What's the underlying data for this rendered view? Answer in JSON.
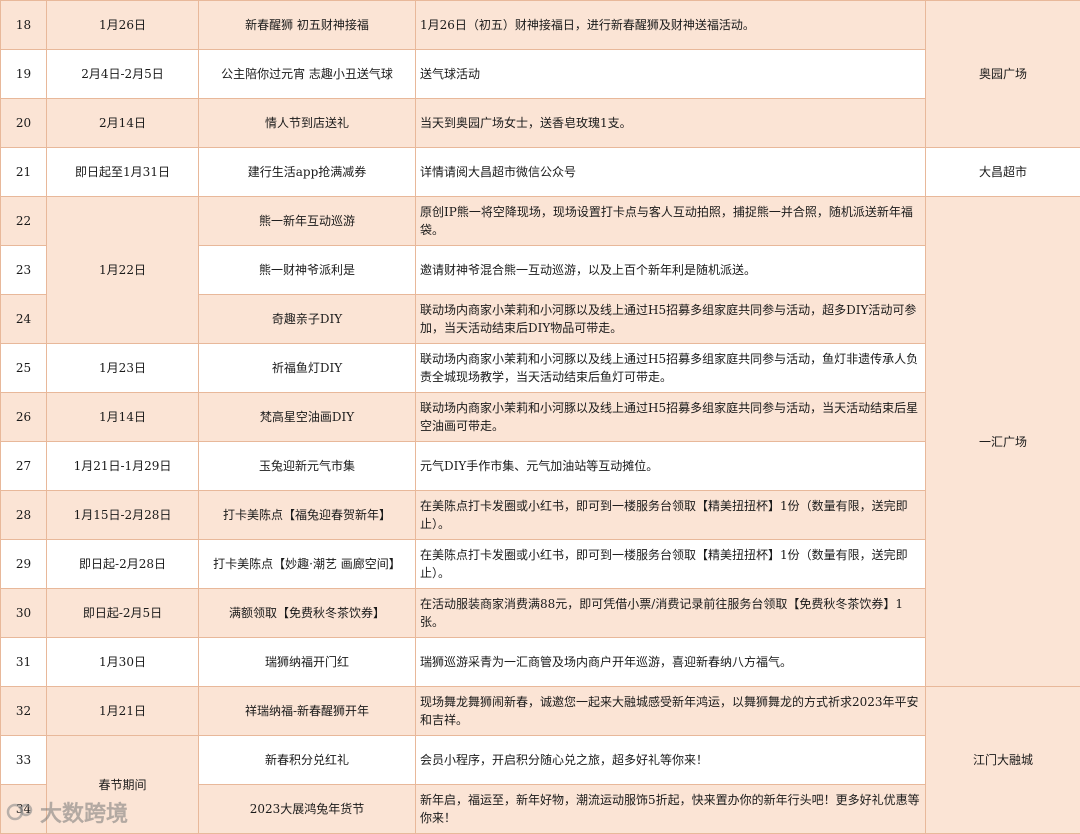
{
  "rows": [
    {
      "no": "18",
      "date": "1月26日",
      "name": "新春醒狮 初五财神接福",
      "desc": "1月26日（初五）财神接福日，进行新春醒狮及财神送福活动。"
    },
    {
      "no": "19",
      "date": "2月4日-2月5日",
      "name": "公主陪你过元宵 志趣小丑送气球",
      "desc": "送气球活动"
    },
    {
      "no": "20",
      "date": "2月14日",
      "name": "情人节到店送礼",
      "desc": "当天到奥园广场女士，送香皂玫瑰1支。"
    },
    {
      "no": "21",
      "date": "即日起至1月31日",
      "name": "建行生活app抢满减券",
      "desc": "详情请阅大昌超市微信公众号"
    },
    {
      "no": "22",
      "date": "",
      "name": "熊一新年互动巡游",
      "desc": "原创IP熊一将空降现场，现场设置打卡点与客人互动拍照，捕捉熊一并合照，随机派送新年福袋。"
    },
    {
      "no": "23",
      "date": "1月22日",
      "name": "熊一财神爷派利是",
      "desc": "邀请财神爷混合熊一互动巡游，以及上百个新年利是随机派送。"
    },
    {
      "no": "24",
      "date": "",
      "name": "奇趣亲子DIY",
      "desc": "联动场内商家小茉莉和小河豚以及线上通过H5招募多组家庭共同参与活动，超多DIY活动可参加，当天活动结束后DIY物品可带走。"
    },
    {
      "no": "25",
      "date": "1月23日",
      "name": "祈福鱼灯DIY",
      "desc": "联动场内商家小茉莉和小河豚以及线上通过H5招募多组家庭共同参与活动，鱼灯非遗传承人负责全城现场教学，当天活动结束后鱼灯可带走。"
    },
    {
      "no": "26",
      "date": "1月14日",
      "name": "梵高星空油画DIY",
      "desc": "联动场内商家小茉莉和小河豚以及线上通过H5招募多组家庭共同参与活动，当天活动结束后星空油画可带走。"
    },
    {
      "no": "27",
      "date": "1月21日-1月29日",
      "name": "玉兔迎新元气市集",
      "desc": "元气DIY手作市集、元气加油站等互动摊位。"
    },
    {
      "no": "28",
      "date": "1月15日-2月28日",
      "name": "打卡美陈点【福兔迎春贺新年】",
      "desc": "在美陈点打卡发圈或小红书，即可到一楼服务台领取【精美扭扭杯】1份（数量有限，送完即止）。"
    },
    {
      "no": "29",
      "date": "即日起-2月28日",
      "name": "打卡美陈点【妙趣·潮艺 画廊空间】",
      "desc": "在美陈点打卡发圈或小红书，即可到一楼服务台领取【精美扭扭杯】1份（数量有限，送完即止）。"
    },
    {
      "no": "30",
      "date": "即日起-2月5日",
      "name": "满额领取【免费秋冬茶饮券】",
      "desc": "在活动服装商家消费满88元，即可凭借小票/消费记录前往服务台领取【免费秋冬茶饮券】1张。"
    },
    {
      "no": "31",
      "date": "1月30日",
      "name": "瑞狮纳福开门红",
      "desc": "瑞狮巡游采青为一汇商管及场内商户开年巡游，喜迎新春纳八方福气。"
    },
    {
      "no": "32",
      "date": "1月21日",
      "name": "祥瑞纳福-新春醒狮开年",
      "desc": "现场舞龙舞狮闹新春，诚邀您一起来大融城感受新年鸿运，以舞狮舞龙的方式祈求2023年平安和吉祥。"
    },
    {
      "no": "33",
      "date": "春节期间",
      "name": "新春积分兑红礼",
      "desc": "会员小程序，开启积分随心兑之旅，超多好礼等你来！"
    },
    {
      "no": "34",
      "date": "",
      "name": "2023大展鸿兔年货节",
      "desc": "新年启，福运至，新年好物，潮流运动服饰5折起，快来置办你的新年行头吧！更多好礼优惠等你来！"
    }
  ],
  "venues": {
    "aoyuan": "奥园广场",
    "dachang": "大昌超市",
    "yihui": "一汇广场",
    "jiangmen": "江门大融城"
  },
  "watermark": {
    "text": "大数跨境"
  }
}
